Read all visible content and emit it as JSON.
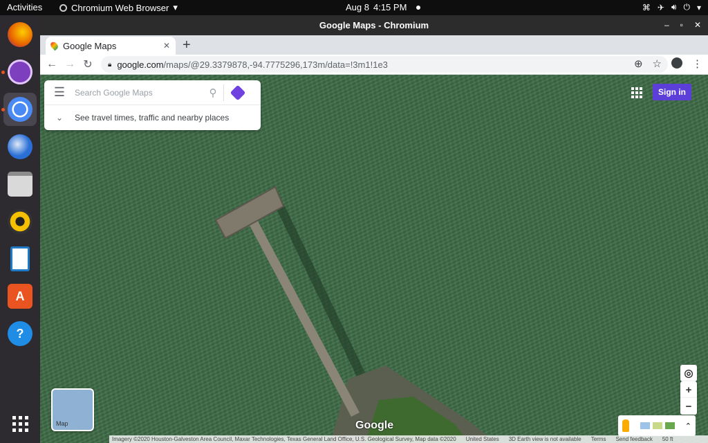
{
  "topbar": {
    "activities": "Activities",
    "app_menu": "Chromium Web Browser",
    "date": "Aug 8",
    "time": "4:15 PM"
  },
  "dock": {
    "items": [
      {
        "name": "firefox",
        "color": "#e66000"
      },
      {
        "name": "tor-browser",
        "color": "#7e3fbf"
      },
      {
        "name": "chromium",
        "color": "#4a8af4"
      },
      {
        "name": "thunderbird",
        "color": "#2a6fd6"
      },
      {
        "name": "files",
        "color": "#cfcfcf"
      },
      {
        "name": "rhythmbox",
        "color": "#f5c000"
      },
      {
        "name": "libreoffice-writer",
        "color": "#1f7ac7"
      },
      {
        "name": "ubuntu-software",
        "color": "#e95420"
      },
      {
        "name": "help",
        "color": "#1f8ce6"
      }
    ]
  },
  "window": {
    "title": "Google Maps - Chromium"
  },
  "tab": {
    "label": "Google Maps"
  },
  "omnibox": {
    "domain": "google.com",
    "path": "/maps/@29.3379878,-94.7775296,173m/data=!3m1!1e3"
  },
  "maps": {
    "search_placeholder": "Search Google Maps",
    "travel_hint": "See travel times, traffic and nearby places",
    "sign_in": "Sign in",
    "layer_label": "Map",
    "logo": "Google",
    "attribution": "Imagery ©2020 Houston-Galveston Area Council, Maxar Technologies, Texas General Land Office, U.S. Geological Survey, Map data ©2020",
    "country": "United States",
    "earth_note": "3D Earth view is not available",
    "terms": "Terms",
    "feedback": "Send feedback",
    "scale": "50 ft"
  },
  "colors": {
    "water": "#3d6b46",
    "signin": "#5b3fd8"
  }
}
